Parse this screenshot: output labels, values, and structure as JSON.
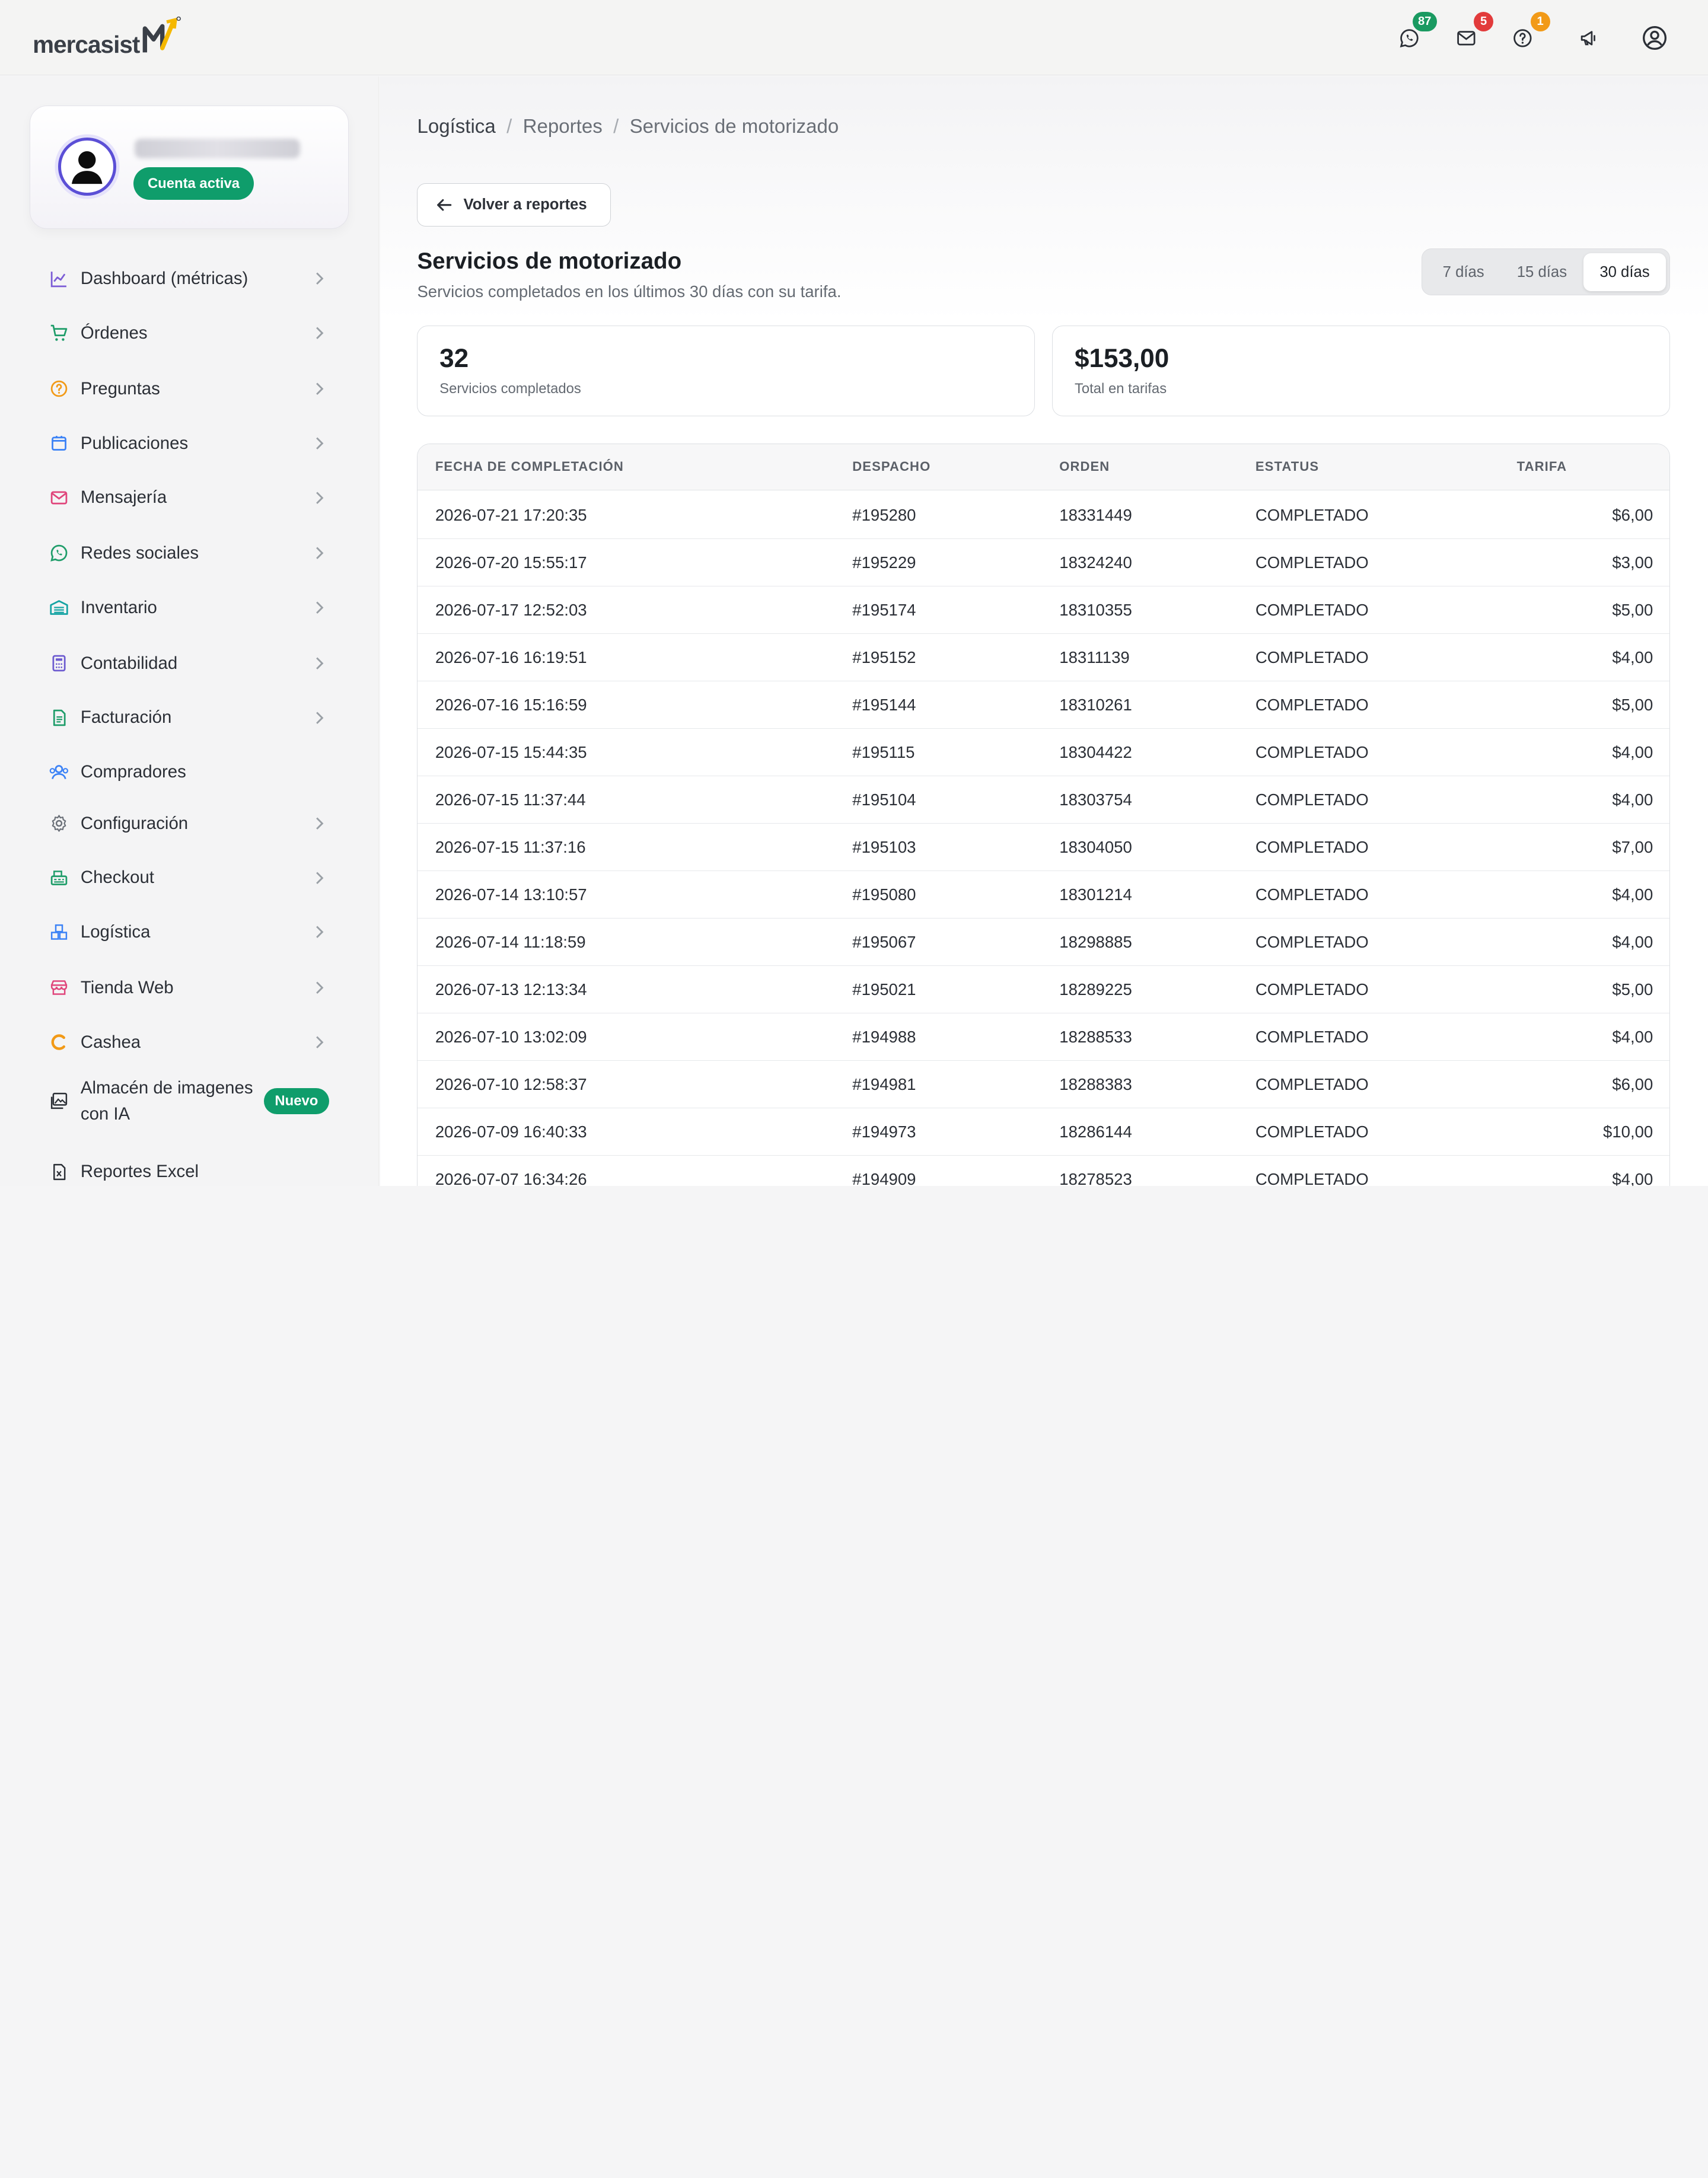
{
  "app": {
    "logo_text": "mercasist",
    "colors": {
      "accent": "#0f9d6b",
      "brand_purple": "#5b4fd6",
      "brand_yellow": "#f5b800"
    }
  },
  "topbar": {
    "icons": [
      {
        "name": "whatsapp-icon",
        "badge": "87",
        "badge_color": "#1a9a61"
      },
      {
        "name": "mail-icon",
        "badge": "5",
        "badge_color": "#e23b3b"
      },
      {
        "name": "help-icon",
        "badge": "1",
        "badge_color": "#f29a17"
      },
      {
        "name": "megaphone-icon"
      },
      {
        "name": "user-circle-icon"
      }
    ]
  },
  "sidebar": {
    "status": "Cuenta activa",
    "items": [
      {
        "label": "Dashboard (métricas)",
        "icon": "chart-line-icon",
        "chevron": true
      },
      {
        "label": "Órdenes",
        "icon": "cart-icon",
        "chevron": true
      },
      {
        "label": "Preguntas",
        "icon": "question-icon",
        "chevron": true
      },
      {
        "label": "Publicaciones",
        "icon": "bag-icon",
        "chevron": true
      },
      {
        "label": "Mensajería",
        "icon": "envelope-icon",
        "chevron": true
      },
      {
        "label": "Redes sociales",
        "icon": "whatsapp-icon",
        "chevron": true
      },
      {
        "label": "Inventario",
        "icon": "warehouse-icon",
        "chevron": true
      },
      {
        "label": "Contabilidad",
        "icon": "calculator-icon",
        "chevron": true
      },
      {
        "label": "Facturación",
        "icon": "invoice-icon",
        "chevron": true
      },
      {
        "label": "Compradores",
        "icon": "users-icon",
        "chevron": false
      },
      {
        "label": "Configuración",
        "icon": "gear-icon",
        "chevron": true
      },
      {
        "label": "Checkout",
        "icon": "register-icon",
        "chevron": true
      },
      {
        "label": "Logística",
        "icon": "boxes-icon",
        "chevron": true
      },
      {
        "label": "Tienda Web",
        "icon": "storefront-icon",
        "chevron": true
      },
      {
        "label": "Cashea",
        "icon": "cashea-c-icon",
        "chevron": true
      },
      {
        "label": "Almacén de imagenes con IA",
        "icon": "images-icon",
        "badge": "Nuevo"
      },
      {
        "label": "Reportes Excel",
        "icon": "excel-icon",
        "chevron": false
      }
    ]
  },
  "breadcrumb": [
    "Logística",
    "Reportes",
    "Servicios de motorizado"
  ],
  "back_button": "Volver a reportes",
  "page": {
    "title": "Servicios de motorizado",
    "subtitle": "Servicios completados en los últimos 30 días con su tarifa."
  },
  "range": {
    "options": [
      "7 días",
      "15 días",
      "30 días"
    ],
    "selected": "30 días"
  },
  "stats": [
    {
      "value": "32",
      "label": "Servicios completados"
    },
    {
      "value": "$153,00",
      "label": "Total en tarifas"
    }
  ],
  "table": {
    "columns": [
      "FECHA DE COMPLETACIÓN",
      "DESPACHO",
      "ORDEN",
      "ESTATUS",
      "TARIFA"
    ],
    "rows": [
      [
        "2026-07-21 17:20:35",
        "#195280",
        "18331449",
        "COMPLETADO",
        "$6,00"
      ],
      [
        "2026-07-20 15:55:17",
        "#195229",
        "18324240",
        "COMPLETADO",
        "$3,00"
      ],
      [
        "2026-07-17 12:52:03",
        "#195174",
        "18310355",
        "COMPLETADO",
        "$5,00"
      ],
      [
        "2026-07-16 16:19:51",
        "#195152",
        "18311139",
        "COMPLETADO",
        "$4,00"
      ],
      [
        "2026-07-16 15:16:59",
        "#195144",
        "18310261",
        "COMPLETADO",
        "$5,00"
      ],
      [
        "2026-07-15 15:44:35",
        "#195115",
        "18304422",
        "COMPLETADO",
        "$4,00"
      ],
      [
        "2026-07-15 11:37:44",
        "#195104",
        "18303754",
        "COMPLETADO",
        "$4,00"
      ],
      [
        "2026-07-15 11:37:16",
        "#195103",
        "18304050",
        "COMPLETADO",
        "$7,00"
      ],
      [
        "2026-07-14 13:10:57",
        "#195080",
        "18301214",
        "COMPLETADO",
        "$4,00"
      ],
      [
        "2026-07-14 11:18:59",
        "#195067",
        "18298885",
        "COMPLETADO",
        "$4,00"
      ],
      [
        "2026-07-13 12:13:34",
        "#195021",
        "18289225",
        "COMPLETADO",
        "$5,00"
      ],
      [
        "2026-07-10 13:02:09",
        "#194988",
        "18288533",
        "COMPLETADO",
        "$4,00"
      ],
      [
        "2026-07-10 12:58:37",
        "#194981",
        "18288383",
        "COMPLETADO",
        "$6,00"
      ],
      [
        "2026-07-09 16:40:33",
        "#194973",
        "18286144",
        "COMPLETADO",
        "$10,00"
      ],
      [
        "2026-07-07 16:34:26",
        "#194909",
        "18278523",
        "COMPLETADO",
        "$4,00"
      ]
    ]
  }
}
